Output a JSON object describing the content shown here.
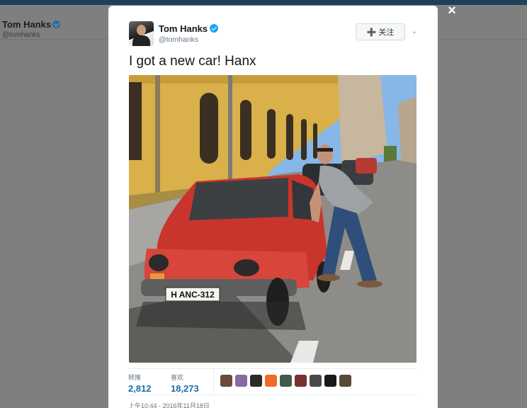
{
  "background": {
    "name": "Tom Hanks",
    "handle": "@tomhanks"
  },
  "close_icon": "×",
  "tweet": {
    "author_name": "Tom Hanks",
    "author_handle": "@tomhanks",
    "follow_label": "关注",
    "text": "I got a new car! Hanx",
    "retweets_label": "转推",
    "retweets_count": "2,812",
    "likes_label": "喜欢",
    "likes_count": "18,273",
    "timestamp": "上午10:44 - 2016年11月18日"
  },
  "photo": {
    "plate_text": "H ANC-312"
  },
  "liker_avatar_colors": [
    "#6b4a3a",
    "#8a6aa0",
    "#2a2a2a",
    "#f26a2a",
    "#3f5a4a",
    "#7a3030",
    "#4a4a4a",
    "#1a1a1a",
    "#5a4a3a"
  ],
  "colors": {
    "accent": "#1da1f2",
    "count_blue": "#1c6ea5",
    "overlay": "#7f7f7f",
    "topbar": "#1b4258"
  }
}
